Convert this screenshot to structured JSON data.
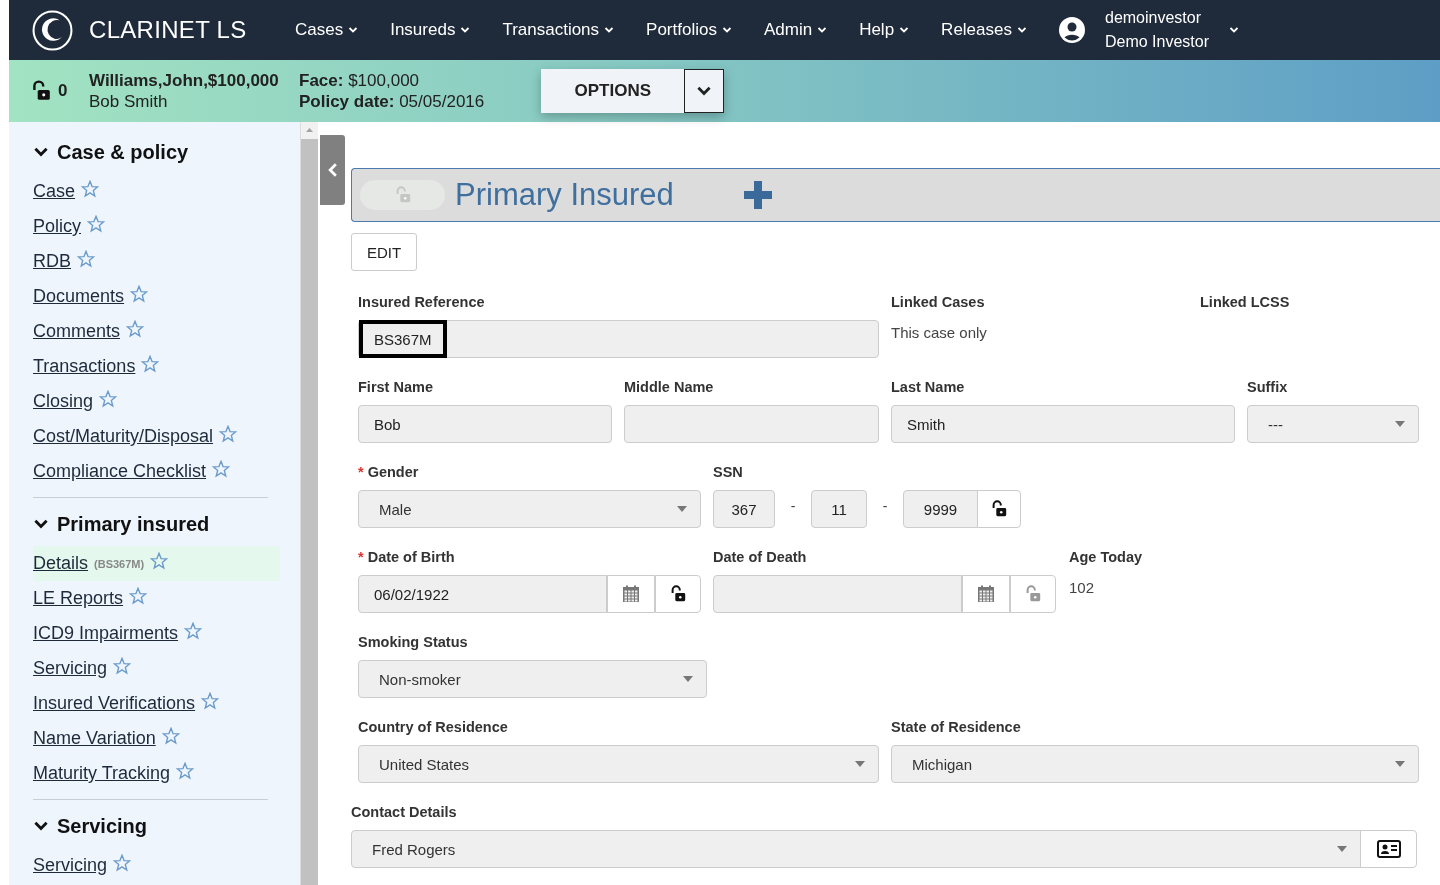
{
  "nav": {
    "logo_text": "CLARINET LS",
    "menus": [
      "Cases",
      "Insureds",
      "Transactions",
      "Portfolios",
      "Admin",
      "Help",
      "Releases"
    ],
    "user": {
      "username": "demoinvestor",
      "display_name": "Demo Investor"
    }
  },
  "case_bar": {
    "lock_count": "0",
    "case_title": "Williams,John,$100,000",
    "insured_name": "Bob Smith",
    "face_label": "Face:",
    "face_value": "$100,000",
    "policy_date_label": "Policy date:",
    "policy_date_value": "05/05/2016",
    "options_button": "OPTIONS"
  },
  "sidebar": {
    "sections": [
      {
        "title": "Case & policy",
        "expanded": true,
        "items": [
          {
            "label": "Case",
            "selected": false
          },
          {
            "label": "Policy",
            "selected": false
          },
          {
            "label": "RDB",
            "selected": false
          },
          {
            "label": "Documents",
            "selected": false
          },
          {
            "label": "Comments",
            "selected": false
          },
          {
            "label": "Transactions",
            "selected": false
          },
          {
            "label": "Closing",
            "selected": false
          },
          {
            "label": "Cost/Maturity/Disposal",
            "selected": false
          },
          {
            "label": "Compliance Checklist",
            "selected": false
          }
        ]
      },
      {
        "title": "Primary insured",
        "expanded": true,
        "items": [
          {
            "label": "Details",
            "tag": "(BS367M)",
            "selected": true
          },
          {
            "label": "LE Reports",
            "selected": false
          },
          {
            "label": "ICD9 Impairments",
            "selected": false
          },
          {
            "label": "Servicing",
            "selected": false
          },
          {
            "label": "Insured Verifications",
            "selected": false
          },
          {
            "label": "Name Variation",
            "selected": false
          },
          {
            "label": "Maturity Tracking",
            "selected": false
          }
        ]
      },
      {
        "title": "Servicing",
        "expanded": true,
        "items": [
          {
            "label": "Servicing",
            "selected": false
          }
        ]
      }
    ]
  },
  "panel": {
    "title": "Primary Insured",
    "edit_button": "EDIT"
  },
  "form_rows": [
    [
      {
        "kind": "reference",
        "label": "Insured Reference",
        "value": "BS367M"
      },
      {
        "kind": "static",
        "label": "Linked Cases",
        "value": "This case only"
      },
      {
        "kind": "static",
        "label": "Linked LCSS"
      }
    ],
    [
      {
        "kind": "text",
        "label": "First Name",
        "value": "Bob"
      },
      {
        "kind": "text",
        "label": "Middle Name"
      },
      {
        "kind": "text",
        "label": "Last Name",
        "value": "Smith"
      },
      {
        "kind": "select",
        "label": "Suffix",
        "value": "---"
      }
    ],
    [
      {
        "kind": "select",
        "label": "Gender",
        "marker": "*",
        "value": "Male"
      },
      {
        "kind": "ssn",
        "label": "SSN",
        "parts": [
          "367",
          "11",
          "9999"
        ],
        "separator": "-"
      }
    ],
    [
      {
        "kind": "date",
        "label": "Date of Birth",
        "marker": "*",
        "value": "06/02/1922",
        "disabled": false
      },
      {
        "kind": "date",
        "label": "Date of Death",
        "disabled": true
      },
      {
        "kind": "static",
        "label": "Age Today",
        "value": "102"
      }
    ],
    [
      {
        "kind": "select",
        "label": "Smoking Status",
        "value": "Non-smoker"
      }
    ],
    [
      {
        "kind": "select",
        "label": "Country of Residence",
        "value": "United States"
      },
      {
        "kind": "select",
        "label": "State of Residence",
        "value": "Michigan"
      }
    ],
    [
      {
        "kind": "contact",
        "label": "Contact Details",
        "value": "Fred Rogers"
      }
    ]
  ]
}
